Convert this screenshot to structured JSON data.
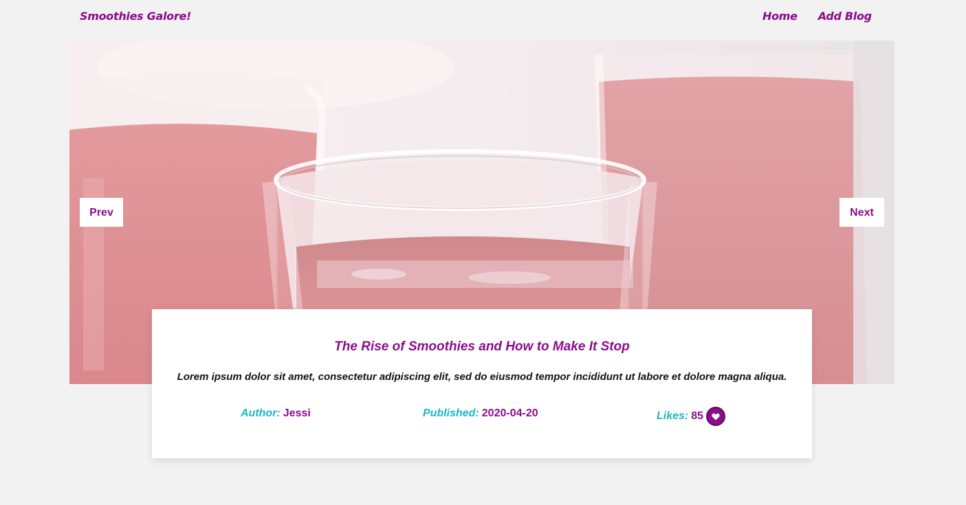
{
  "header": {
    "brand": "Smoothies Galore!",
    "nav": [
      {
        "label": "Home"
      },
      {
        "label": "Add Blog"
      }
    ]
  },
  "slider": {
    "prev_label": "Prev",
    "next_label": "Next"
  },
  "post": {
    "title": "The Rise of Smoothies and How to Make It Stop",
    "excerpt": "Lorem ipsum dolor sit amet, consectetur adipiscing elit, sed do eiusmod tempor incididunt ut labore et dolore magna aliqua.",
    "author_label": "Author:",
    "author": "Jessi",
    "published_label": "Published:",
    "published": "2020-04-20",
    "likes_label": "Likes:",
    "likes": "85",
    "like_icon": "heart-icon"
  },
  "colors": {
    "accent": "#8b0c8c",
    "label": "#1ab8c4",
    "background": "#f2f2f2"
  }
}
